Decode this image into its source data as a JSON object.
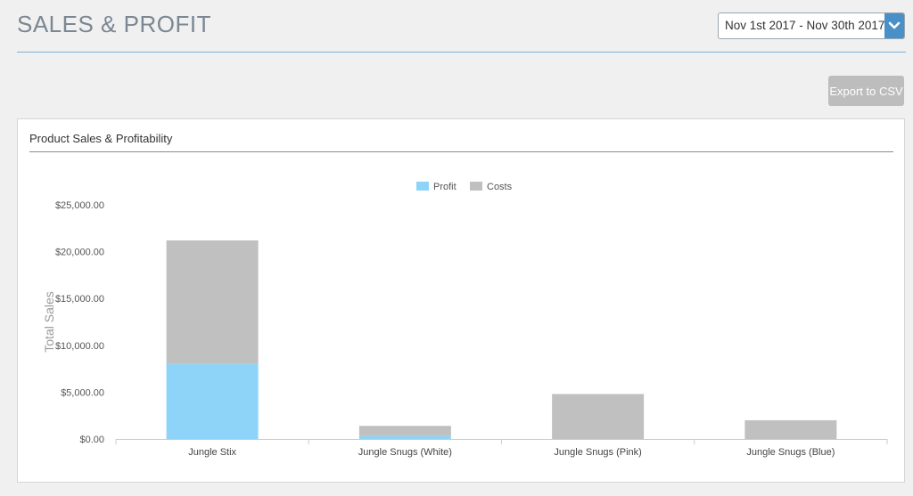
{
  "header": {
    "title": "SALES & PROFIT",
    "date_range": "Nov 1st 2017 - Nov 30th 2017",
    "export_label": "Export to CSV"
  },
  "panel": {
    "title": "Product Sales & Profitability"
  },
  "colors": {
    "profit": "#8ed4f8",
    "costs": "#c0c0c0",
    "accent": "#4a90c8"
  },
  "icons": {
    "date_dropdown": "chevron-down-icon"
  },
  "chart_data": {
    "type": "bar",
    "stacked": true,
    "categories": [
      "Jungle Stix",
      "Jungle Snugs (White)",
      "Jungle Snugs (Pink)",
      "Jungle Snugs (Blue)"
    ],
    "series": [
      {
        "name": "Profit",
        "values": [
          8000,
          300,
          0,
          0
        ]
      },
      {
        "name": "Costs",
        "values": [
          13200,
          1100,
          4800,
          2000
        ]
      }
    ],
    "ylabel": "Total Sales",
    "xlabel": "",
    "ylim": [
      0,
      25000
    ],
    "yticks": [
      "$0.00",
      "$5,000.00",
      "$10,000.00",
      "$15,000.00",
      "$20,000.00",
      "$25,000.00"
    ],
    "legend_position": "top-center",
    "grid": false
  }
}
